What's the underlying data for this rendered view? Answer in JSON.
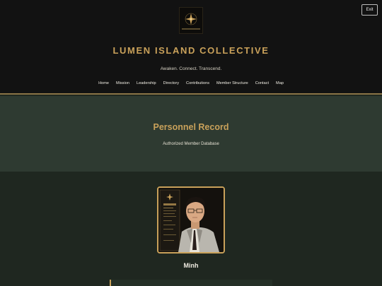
{
  "header": {
    "title": "LUMEN ISLAND COLLECTIVE",
    "tagline": "Awaken. Connect. Transcend.",
    "exit_label": "Exit",
    "logo_icon": "star-emblem-icon"
  },
  "nav": {
    "items": [
      {
        "label": "Home"
      },
      {
        "label": "Mission"
      },
      {
        "label": "Leadership"
      },
      {
        "label": "Directory"
      },
      {
        "label": "Contributions"
      },
      {
        "label": "Member Structure"
      },
      {
        "label": "Contact"
      },
      {
        "label": "Map"
      }
    ]
  },
  "hero": {
    "title": "Personnel Record",
    "subtitle": "Authorized Member Database"
  },
  "profile": {
    "name": "Minh"
  },
  "colors": {
    "accent": "#c9a15a",
    "header_bg": "#121212",
    "hero_bg": "#2e3a31",
    "page_bg": "#1f2720"
  }
}
